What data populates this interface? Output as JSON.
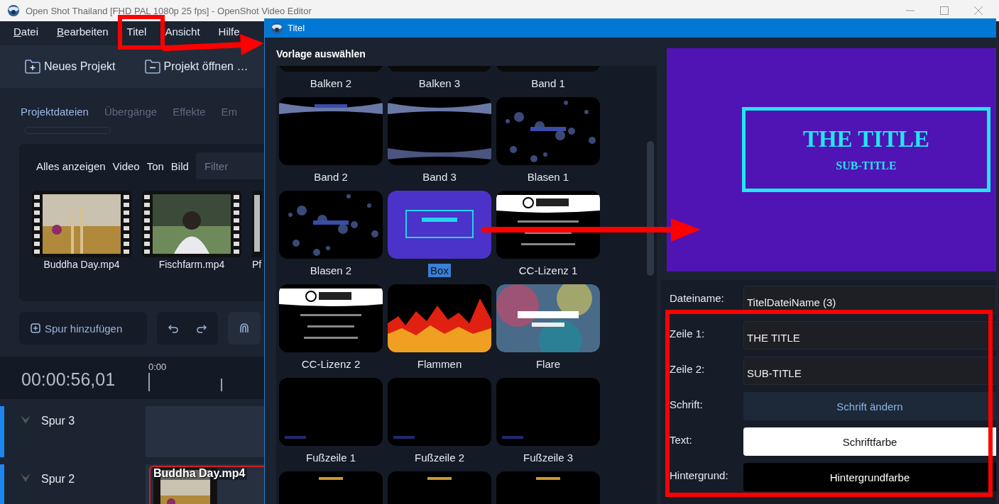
{
  "window": {
    "title": "Open Shot Thailand [FHD PAL 1080p 25 fps] - OpenShot Video Editor"
  },
  "menu": [
    {
      "label": "Datei",
      "accel": true
    },
    {
      "label": "Bearbeiten",
      "accel": true
    },
    {
      "label": "Titel",
      "accel": false
    },
    {
      "label": "Ansicht",
      "accel": false
    },
    {
      "label": "Hilfe",
      "accel": false
    }
  ],
  "toolbar": [
    {
      "label": "Neues Projekt",
      "kind": "new"
    },
    {
      "label": "Projekt öffnen …",
      "kind": "open"
    }
  ],
  "tabs": [
    {
      "label": "Projektdateien",
      "selected": true
    },
    {
      "label": "Übergänge",
      "selected": false
    },
    {
      "label": "Effekte",
      "selected": false
    },
    {
      "label": "Em",
      "selected": false
    }
  ],
  "filters": [
    "Alles anzeigen",
    "Video",
    "Ton",
    "Bild"
  ],
  "filter_field": {
    "placeholder": "Filter"
  },
  "files": [
    {
      "name": "Buddha Day.mp4",
      "kind": "picture"
    },
    {
      "name": "Fischfarm.mp4",
      "kind": "picture"
    },
    {
      "name": "Pf",
      "kind": "partial"
    }
  ],
  "timeline_toolbar": {
    "add_track": "Spur hinzufügen"
  },
  "timecode": "00:00:56,01",
  "ruler": "0:00",
  "tracks": [
    {
      "name": "Spur 3"
    },
    {
      "name": "Spur 2",
      "clip": "Buddha Day.mp4"
    }
  ],
  "dialog": {
    "title": "Titel",
    "heading": "Vorlage auswählen",
    "templates": [
      {
        "name": "Balken 2",
        "kind": "bars",
        "selected": false
      },
      {
        "name": "Balken 3",
        "kind": "bars",
        "selected": false
      },
      {
        "name": "Band 1",
        "kind": "bars",
        "selected": false
      },
      {
        "name": "Band 2",
        "kind": "band",
        "selected": false
      },
      {
        "name": "Band 3",
        "kind": "band2",
        "selected": false
      },
      {
        "name": "Blasen 1",
        "kind": "bubbles",
        "selected": false
      },
      {
        "name": "Blasen 2",
        "kind": "bubbles",
        "selected": false
      },
      {
        "name": "Box",
        "kind": "box",
        "selected": true
      },
      {
        "name": "CC-Lizenz 1",
        "kind": "cc",
        "selected": false
      },
      {
        "name": "CC-Lizenz 2",
        "kind": "cc",
        "selected": false
      },
      {
        "name": "Flammen",
        "kind": "flames",
        "selected": false
      },
      {
        "name": "Flare",
        "kind": "flare",
        "selected": false
      },
      {
        "name": "Fußzeile 1",
        "kind": "footer",
        "selected": false
      },
      {
        "name": "Fußzeile 2",
        "kind": "footer",
        "selected": false
      },
      {
        "name": "Fußzeile 3",
        "kind": "footer",
        "selected": false
      },
      {
        "kind": "gold",
        "selected": false
      },
      {
        "kind": "gold",
        "selected": false
      },
      {
        "kind": "gold",
        "selected": false
      }
    ],
    "preview": {
      "title": "THE TITLE",
      "subtitle": "SUB-TITLE"
    },
    "form": [
      {
        "label": "Dateiname:",
        "kind": "input",
        "value": "TitelDateiName (3)"
      },
      {
        "label": "Zeile 1:",
        "kind": "input",
        "value": "THE TITLE"
      },
      {
        "label": "Zeile 2:",
        "kind": "input",
        "value": "SUB-TITLE"
      },
      {
        "label": "Schrift:",
        "kind": "button",
        "value": "Schrift ändern"
      },
      {
        "label": "Text:",
        "kind": "color",
        "value": "Schriftfarbe",
        "color": "#ffffff"
      },
      {
        "label": "Hintergrund:",
        "kind": "color",
        "value": "Hintergrundfarbe",
        "color": "#000000"
      }
    ]
  }
}
